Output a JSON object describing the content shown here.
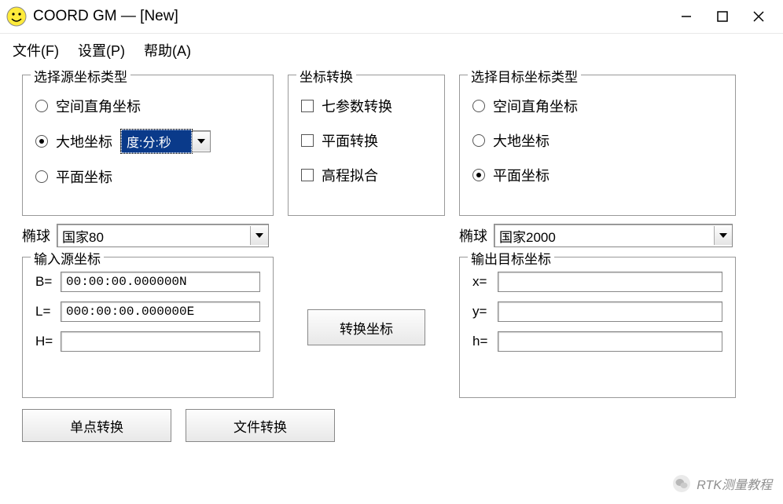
{
  "window": {
    "title": "COORD GM — [New]"
  },
  "menu": {
    "file": "文件(F)",
    "settings": "设置(P)",
    "help": "帮助(A)"
  },
  "source_type_group": {
    "legend": "选择源坐标类型",
    "opt_cartesian": "空间直角坐标",
    "opt_geodetic": "大地坐标",
    "opt_planar": "平面坐标",
    "selected": "opt_geodetic",
    "dms_combo": "度:分:秒"
  },
  "transform_group": {
    "legend": "坐标转换",
    "chk_seven": "七参数转换",
    "chk_planar": "平面转换",
    "chk_height": "高程拟合"
  },
  "target_type_group": {
    "legend": "选择目标坐标类型",
    "opt_cartesian": "空间直角坐标",
    "opt_geodetic": "大地坐标",
    "opt_planar": "平面坐标",
    "selected": "opt_planar"
  },
  "ellipsoid": {
    "label": "椭球",
    "source": "国家80",
    "target": "国家2000"
  },
  "input_group": {
    "legend": "输入源坐标",
    "b_label": "B=",
    "b_value": "00:00:00.000000N",
    "l_label": "L=",
    "l_value": "000:00:00.000000E",
    "h_label": "H=",
    "h_value": ""
  },
  "output_group": {
    "legend": "输出目标坐标",
    "x_label": "x=",
    "x_value": "",
    "y_label": "y=",
    "y_value": "",
    "h_label": "h=",
    "h_value": ""
  },
  "buttons": {
    "convert": "转换坐标",
    "single": "单点转换",
    "file": "文件转换"
  },
  "watermark": {
    "text": "RTK测量教程"
  }
}
